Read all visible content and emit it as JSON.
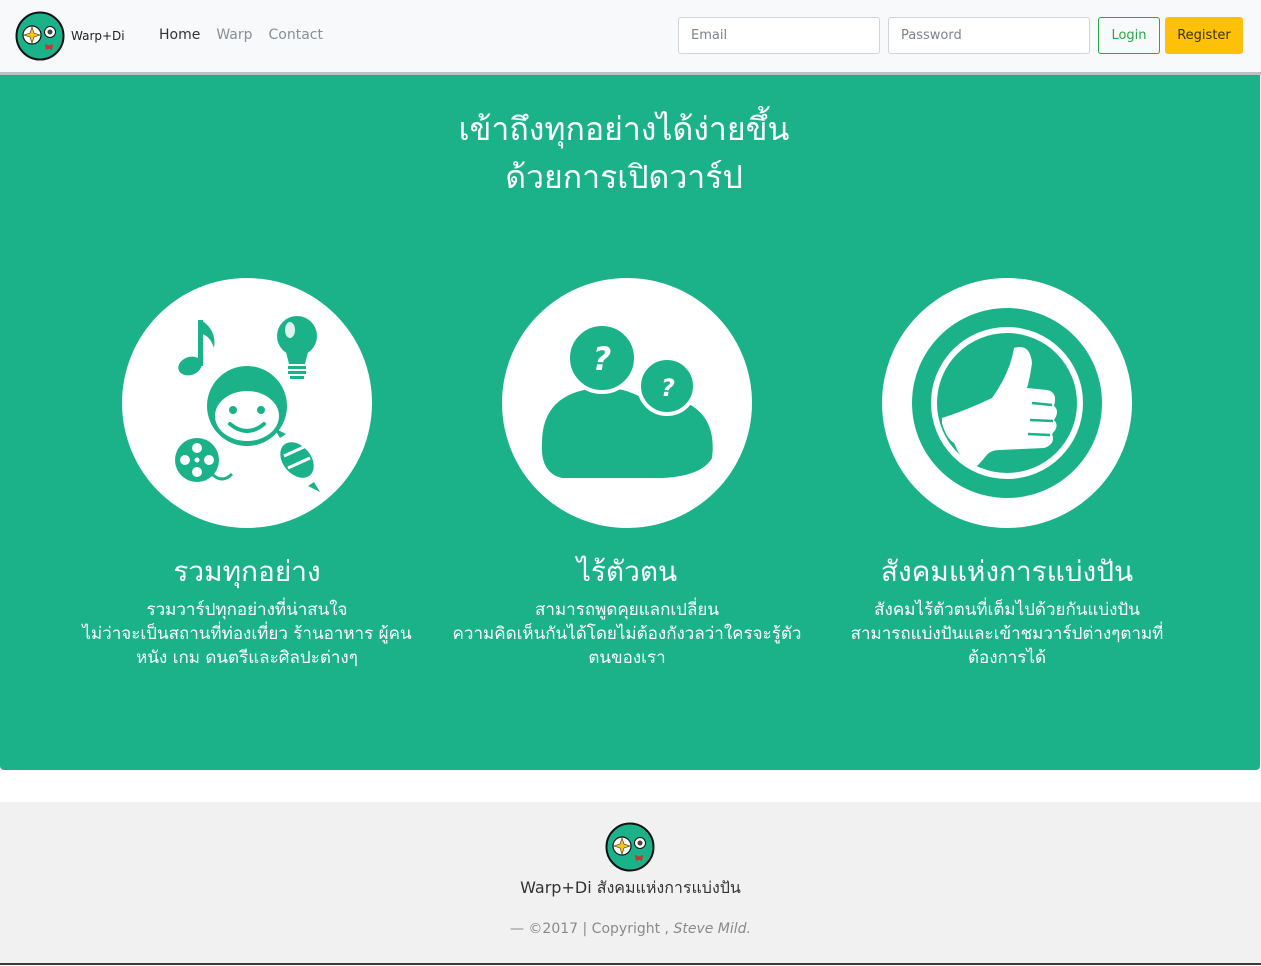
{
  "navbar": {
    "brand": "Warp+Di",
    "links": [
      {
        "label": "Home",
        "active": true
      },
      {
        "label": "Warp",
        "active": false
      },
      {
        "label": "Contact",
        "active": false
      }
    ],
    "email_placeholder": "Email",
    "password_placeholder": "Password",
    "login_label": "Login",
    "register_label": "Register"
  },
  "hero": {
    "title_line1": "เข้าถึงทุกอย่างได้ง่ายขึ้น",
    "title_line2": "ด้วยการเปิดวาร์ป",
    "features": [
      {
        "icon": "entertainment-icon",
        "title": "รวมทุกอย่าง",
        "lines": [
          "รวมวาร์ปทุกอย่างที่น่าสนใจ",
          "ไม่ว่าจะเป็นสถานที่ท่องเที่ยว ร้านอาหาร ผู้คน",
          "หนัง เกม ดนตรีและศิลปะต่างๆ"
        ]
      },
      {
        "icon": "anonymous-people-icon",
        "title": "ไร้ตัวตน",
        "lines": [
          "สามารถพูดคุยแลกเปลี่ยน",
          "ความคิดเห็นกันได้โดยไม่ต้องกังวลว่าใครจะรู้ตัว",
          "ตนของเรา"
        ]
      },
      {
        "icon": "thumbs-up-icon",
        "title": "สังคมแห่งการแบ่งปัน",
        "lines": [
          "สังคมไร้ตัวตนที่เต็มไปด้วยกันแบ่งปัน",
          "สามารถแบ่งปันและเข้าชมวาร์ปต่างๆตามที่",
          "ต้องการได้"
        ]
      }
    ]
  },
  "footer": {
    "name": "Warp+Di สังคมแห่งการแบ่งปัน",
    "copy_prefix": "—  ©2017 | Copyright ,",
    "copy_author": "Steve Mild."
  },
  "colors": {
    "hero_bg": "#1bb28a",
    "login_border": "#28a745",
    "register_bg": "#ffc107",
    "footer_bg": "#f1f1f1"
  }
}
